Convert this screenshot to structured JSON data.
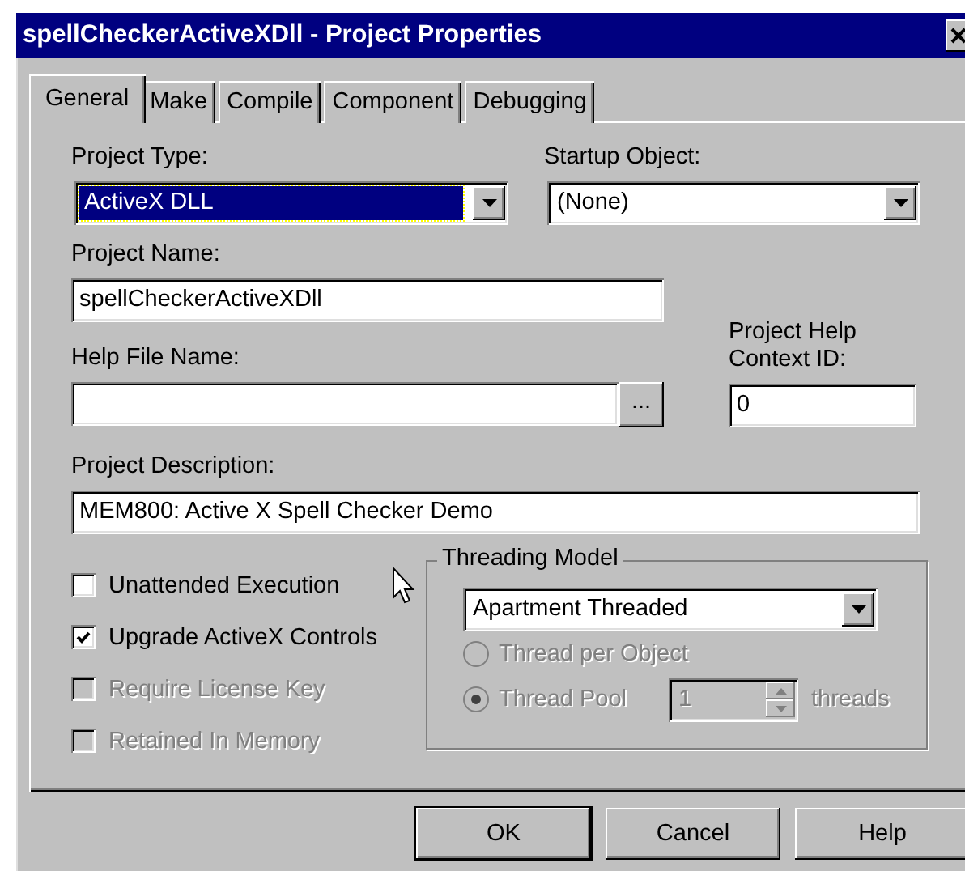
{
  "window": {
    "title": "spellCheckerActiveXDll - Project Properties"
  },
  "tabs": [
    {
      "label": "General",
      "selected": true
    },
    {
      "label": "Make",
      "selected": false
    },
    {
      "label": "Compile",
      "selected": false
    },
    {
      "label": "Component",
      "selected": false
    },
    {
      "label": "Debugging",
      "selected": false
    }
  ],
  "project_type": {
    "label": "Project Type:",
    "value": "ActiveX DLL",
    "highlighted": true
  },
  "startup_object": {
    "label": "Startup Object:",
    "value": "(None)",
    "highlighted": false
  },
  "project_name": {
    "label": "Project Name:",
    "value": "spellCheckerActiveXDll"
  },
  "help_file_name": {
    "label": "Help File Name:",
    "browse_button": "..."
  },
  "help_context_id": {
    "label": "Project Help Context ID:",
    "value": "0"
  },
  "project_description": {
    "label": "Project Description:",
    "value": "MEM800: Active X Spell Checker Demo"
  },
  "checkboxes": [
    {
      "label": "Unattended Execution",
      "checked": false,
      "disabled": false
    },
    {
      "label": "Upgrade ActiveX Controls",
      "checked": true,
      "disabled": false
    },
    {
      "label": "Require License Key",
      "checked": false,
      "disabled": true
    },
    {
      "label": "Retained In Memory",
      "checked": false,
      "disabled": true
    }
  ],
  "threading_model": {
    "label": "Threading Model",
    "value": "Apartment Threaded",
    "options": [
      {
        "label": "Thread per Object",
        "selected": false,
        "disabled": true
      },
      {
        "label": "Thread Pool",
        "selected": true,
        "disabled": true
      }
    ],
    "thread_count": {
      "value": "1",
      "disabled": true
    },
    "unit": "threads"
  },
  "buttons": [
    {
      "label": "OK",
      "default": true
    },
    {
      "label": "Cancel",
      "default": false
    },
    {
      "label": "Help",
      "default": false
    }
  ]
}
